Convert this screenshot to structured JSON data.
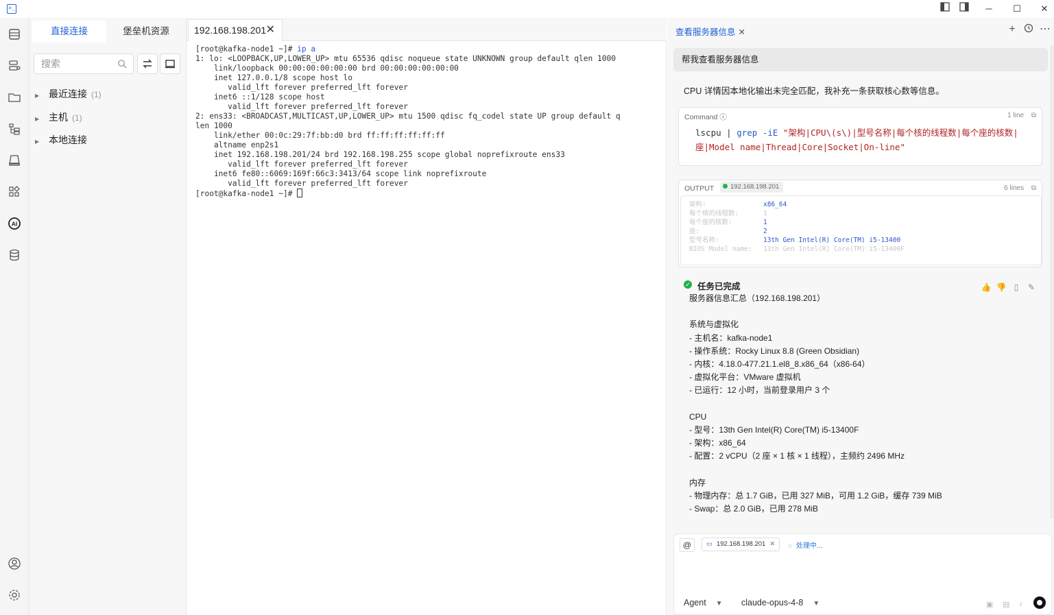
{
  "titlebar": {
    "icons": [
      "layout-left-icon",
      "layout-split-icon",
      "minimize-icon",
      "maximize-icon",
      "close-icon"
    ]
  },
  "activity_bar": {
    "items": [
      "sessions-icon",
      "servers-icon",
      "folder-icon",
      "tree-icon",
      "storage-icon",
      "apps-icon",
      "ai-icon",
      "database-icon"
    ],
    "bottom": [
      "user-icon",
      "settings-icon"
    ]
  },
  "sidebar": {
    "tabs": [
      {
        "label": "直接连接"
      },
      {
        "label": "堡垒机资源"
      }
    ],
    "search": {
      "placeholder": "搜索"
    },
    "tree": [
      {
        "label": "最近连接",
        "count": "(1)"
      },
      {
        "label": "主机",
        "count": "(1)"
      },
      {
        "label": "本地连接",
        "count": ""
      }
    ]
  },
  "terminal": {
    "tab_title": "192.168.198.201",
    "lines": [
      {
        "prompt": "[root@kafka-node1 ~]# ",
        "cmd": "ip a"
      },
      {
        "text": "1: lo: <LOOPBACK,UP,LOWER_UP> mtu 65536 qdisc noqueue state UNKNOWN group default qlen 1000"
      },
      {
        "text": "    link/loopback 00:00:00:00:00:00 brd 00:00:00:00:00:00"
      },
      {
        "text": "    inet 127.0.0.1/8 scope host lo"
      },
      {
        "text": "       valid_lft forever preferred_lft forever"
      },
      {
        "text": "    inet6 ::1/128 scope host"
      },
      {
        "text": "       valid_lft forever preferred_lft forever"
      },
      {
        "text": "2: ens33: <BROADCAST,MULTICAST,UP,LOWER_UP> mtu 1500 qdisc fq_codel state UP group default q"
      },
      {
        "text": "len 1000"
      },
      {
        "text": "    link/ether 00:0c:29:7f:bb:d0 brd ff:ff:ff:ff:ff:ff"
      },
      {
        "text": "    altname enp2s1"
      },
      {
        "text": "    inet 192.168.198.201/24 brd 192.168.198.255 scope global noprefixroute ens33"
      },
      {
        "text": "       valid_lft forever preferred_lft forever"
      },
      {
        "text": "    inet6 fe80::6069:169f:66c3:3413/64 scope link noprefixroute"
      },
      {
        "text": "       valid_lft forever preferred_lft forever"
      },
      {
        "prompt": "[root@kafka-node1 ~]# ",
        "cmd": ""
      }
    ]
  },
  "ai_panel": {
    "tab_title": "查看服务器信息",
    "user_message": "帮我查看服务器信息",
    "assistant_note": "CPU 详情因本地化输出未完全匹配，我补充一条获取核心数等信息。",
    "command_card": {
      "label": "Command",
      "lines": "1 line",
      "cmd_prefix": "lscpu | ",
      "cmd_grep": "grep -iE ",
      "cmd_string": "\"架构|CPU\\(s\\)|型号名称|每个核的线程数|每个座的核数|座|Model name|Thread|Core|Socket|On-line\""
    },
    "output_card": {
      "label": "OUTPUT",
      "host": "192.168.198.201",
      "lines": "6 lines",
      "rows": [
        {
          "key": "架构:",
          "value": "x86_64",
          "faint": false
        },
        {
          "key": "每个核的线程数:",
          "value": "1",
          "faint": true
        },
        {
          "key": "每个座的核数:",
          "value": "1",
          "faint": false
        },
        {
          "key": "座:",
          "value": "2",
          "faint": false
        },
        {
          "key": "型号名称:",
          "value": "13th Gen Intel(R) Core(TM) i5-13400",
          "faint": false
        },
        {
          "key": "BIOS Model name:",
          "value": "13th Gen Intel(R) Core(TM) i5-13400F",
          "faint": true
        }
      ]
    },
    "task_status": "任务已完成",
    "summary": [
      "服务器信息汇总（192.168.198.201）",
      "",
      "系统与虚拟化",
      "- 主机名：kafka-node1",
      "- 操作系统：Rocky Linux 8.8 (Green Obsidian)",
      "- 内核：4.18.0-477.21.1.el8_8.x86_64（x86-64）",
      "- 虚拟化平台：VMware 虚拟机",
      "- 已运行：12 小时，当前登录用户 3 个",
      "",
      "CPU",
      "- 型号：13th Gen Intel(R) Core(TM) i5-13400F",
      "- 架构：x86_64",
      "- 配置：2 vCPU（2 座 × 1 核 × 1 线程），主频约 2496 MHz",
      "",
      "内存",
      "- 物理内存：总 1.7 GiB，已用 327 MiB，可用 1.2 GiB，缓存 739 MiB",
      "- Swap：总 2.0 GiB，已用 278 MiB"
    ],
    "input": {
      "at_label": "@",
      "context_host": "192.168.198.201",
      "processing": "处理中...",
      "mode": "Agent",
      "model": "claude-opus-4-8"
    }
  },
  "colors": {
    "accent": "#1d5fd8",
    "success": "#22b14c",
    "string": "#b22222"
  }
}
